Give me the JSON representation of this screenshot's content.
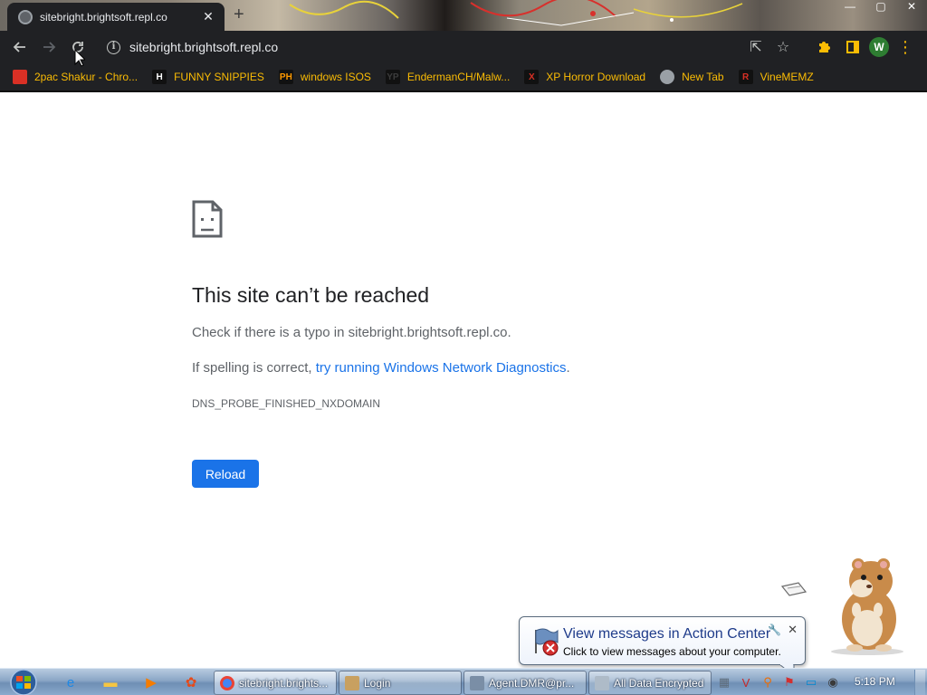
{
  "browser": {
    "tab": {
      "title": "sitebright.brightsoft.repl.co",
      "close_glyph": "✕"
    },
    "new_tab_glyph": "+",
    "window_controls": {
      "minimize": "—",
      "maximize": "▢",
      "close": "✕"
    },
    "address_bar": {
      "url": "sitebright.brightsoft.repl.co"
    },
    "profile_initial": "W"
  },
  "bookmarks": [
    {
      "label": "2pac Shakur - Chro...",
      "icon": "red-gift-icon",
      "icon_text": "",
      "icon_color": "#d93025"
    },
    {
      "label": "FUNNY SNIPPIES",
      "icon": "h-logo-icon",
      "icon_text": "H",
      "icon_color": "#ffffff"
    },
    {
      "label": "windows ISOS",
      "icon": "ph-logo-icon",
      "icon_text": "PH",
      "icon_color": "#ff9900"
    },
    {
      "label": "EndermanCH/Malw...",
      "icon": "yp-logo-icon",
      "icon_text": "YP",
      "icon_color": "#3c3c3c"
    },
    {
      "label": "XP Horror Download",
      "icon": "x-logo-icon",
      "icon_text": "X",
      "icon_color": "#d93025"
    },
    {
      "label": "New Tab",
      "icon": "globe-icon",
      "icon_text": "",
      "icon_color": "#9aa0a6"
    },
    {
      "label": "VineMEMZ",
      "icon": "r-logo-icon",
      "icon_text": "R",
      "icon_color": "#d93025"
    }
  ],
  "error_page": {
    "title": "This site can’t be reached",
    "line1": "Check if there is a typo in sitebright.brightsoft.repl.co.",
    "line2_prefix": "If spelling is correct, ",
    "line2_link": "try running Windows Network Diagnostics",
    "line2_suffix": ".",
    "error_code": "DNS_PROBE_FINISHED_NXDOMAIN",
    "reload_label": "Reload"
  },
  "notification": {
    "title": "View messages in Action Center",
    "subtitle": "Click to view messages about your computer."
  },
  "taskbar": {
    "pinned": [
      {
        "name": "ie-icon",
        "glyph": "e",
        "color": "#1e88e5"
      },
      {
        "name": "explorer-icon",
        "glyph": "▬",
        "color": "#f5c542"
      },
      {
        "name": "media-player-icon",
        "glyph": "▶",
        "color": "#f57c00"
      },
      {
        "name": "app-icon",
        "glyph": "✿",
        "color": "#e64a19"
      }
    ],
    "tasks": [
      {
        "label": "sitebright.brights...",
        "icon": "chrome-icon",
        "active": true
      },
      {
        "label": "Login",
        "icon": "login-app-icon",
        "active": false
      },
      {
        "label": "Agent.DMR@pr...",
        "icon": "agent-app-icon",
        "active": false
      },
      {
        "label": "All Data Encrypted",
        "icon": "encrypted-app-icon",
        "active": false
      }
    ],
    "tray": [
      {
        "name": "tray-app-icon",
        "glyph": "▦",
        "color": "#5d6b7a"
      },
      {
        "name": "tray-v-icon",
        "glyph": "V",
        "color": "#c62828"
      },
      {
        "name": "tray-search-icon",
        "glyph": "⚲",
        "color": "#ef6c00"
      },
      {
        "name": "tray-flag-icon",
        "glyph": "⚑",
        "color": "#d32f2f"
      },
      {
        "name": "tray-monitor-icon",
        "glyph": "▭",
        "color": "#0288d1"
      },
      {
        "name": "tray-volume-icon",
        "glyph": "◉",
        "color": "#3a3a3a"
      }
    ],
    "clock": "5:18 PM"
  }
}
